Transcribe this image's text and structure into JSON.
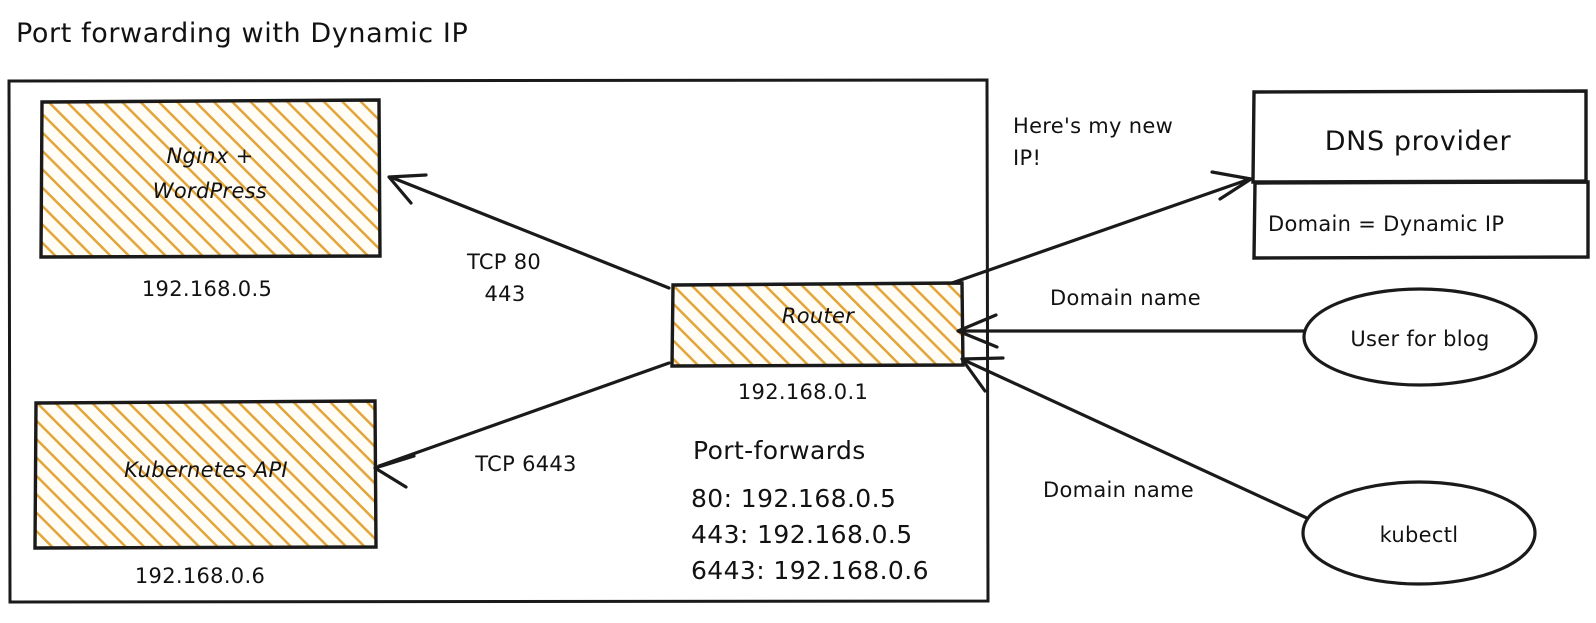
{
  "title": "Port forwarding with Dynamic IP",
  "colors": {
    "hatch": "#e3a53a",
    "hatch_bg": "#fffdf5",
    "stroke": "#1a1a1a",
    "background": "#ffffff"
  },
  "lan": {
    "nodes": [
      {
        "id": "nginx-wordpress",
        "label_line1": "Nginx +",
        "label_line2": "WordPress",
        "ip": "192.168.0.5"
      },
      {
        "id": "kubernetes-api",
        "label_line1": "Kubernetes API",
        "label_line2": "",
        "ip": "192.168.0.6"
      },
      {
        "id": "router",
        "label_line1": "Router",
        "label_line2": "",
        "ip": "192.168.0.1"
      }
    ],
    "port_forwards": {
      "heading": "Port-forwards",
      "entries": [
        "80: 192.168.0.5",
        "443: 192.168.0.5",
        "6443: 192.168.0.6"
      ]
    },
    "edge_labels": {
      "tcp_web_line1": "TCP 80",
      "tcp_web_line2": "443",
      "tcp_k8s": "TCP 6443"
    }
  },
  "external": {
    "dns_provider": {
      "header": "DNS provider",
      "body": "Domain = Dynamic IP"
    },
    "actors": [
      {
        "id": "user-for-blog",
        "label": "User for blog"
      },
      {
        "id": "kubectl",
        "label": "kubectl"
      }
    ],
    "edge_labels": {
      "dynamic_dns_line1": "Here's my new",
      "dynamic_dns_line2": "IP!",
      "domain_name_blog": "Domain name",
      "domain_name_kubectl": "Domain name"
    }
  }
}
